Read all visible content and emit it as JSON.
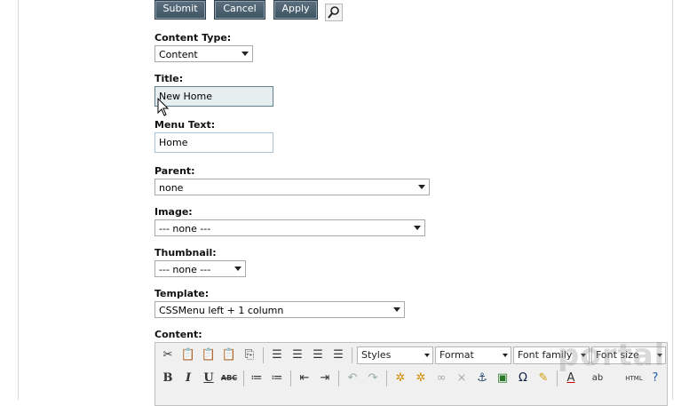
{
  "buttons": {
    "submit": "Submit",
    "cancel": "Cancel",
    "apply": "Apply"
  },
  "form": {
    "content_type_label": "Content Type:",
    "content_type_value": "Content",
    "title_label": "Title:",
    "title_value": "New Home",
    "menu_text_label": "Menu Text:",
    "menu_text_value": "Home",
    "parent_label": "Parent:",
    "parent_value": "none",
    "image_label": "Image:",
    "image_value": "--- none ---",
    "thumbnail_label": "Thumbnail:",
    "thumbnail_value": "--- none ---",
    "template_label": "Template:",
    "template_value": "CSSMenu left + 1 column",
    "content_label": "Content:"
  },
  "editor": {
    "styles": "Styles",
    "format": "Format",
    "font_family": "Font family",
    "font_size": "Font size",
    "bold": "B",
    "italic": "I",
    "underline": "U",
    "strike": "ABC",
    "html": "HTML"
  },
  "watermark": "portal",
  "colors": {
    "button_bg": "#4c6070",
    "input_border": "#7aa0c0",
    "title_bg": "#e6eef0"
  }
}
